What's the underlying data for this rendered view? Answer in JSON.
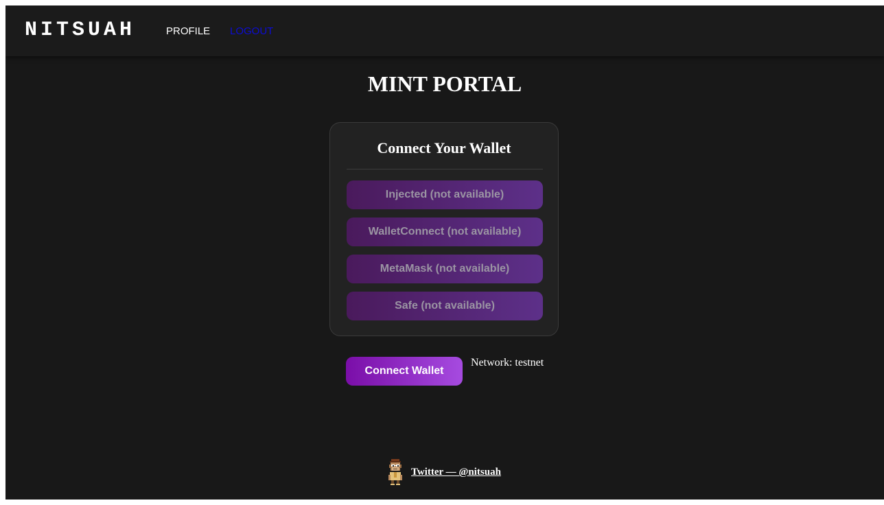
{
  "nav": {
    "logo": "NITSUAH",
    "links": [
      {
        "label": "PROFILE",
        "color": "#ffffff"
      },
      {
        "label": "LOGOUT",
        "color": "#0c0cd6"
      }
    ]
  },
  "page": {
    "title": "MINT PORTAL"
  },
  "wallet_card": {
    "title": "Connect Your Wallet",
    "options": [
      {
        "label": "Injected (not available)"
      },
      {
        "label": "WalletConnect (not available)"
      },
      {
        "label": "MetaMask (not available)"
      },
      {
        "label": "Safe (not available)"
      }
    ]
  },
  "actions": {
    "connect_label": "Connect Wallet",
    "network_text": "Network: testnet"
  },
  "footer": {
    "twitter_label": "Twitter — @nitsuah",
    "avatar_icon": "pixel-ape-avatar-icon"
  },
  "colors": {
    "background": "#181818",
    "navbar": "#1b1b1b",
    "accent_start": "#7a0ea8",
    "accent_end": "#a64be0",
    "option_start": "#4a1a5c",
    "option_end": "#5d3089"
  }
}
